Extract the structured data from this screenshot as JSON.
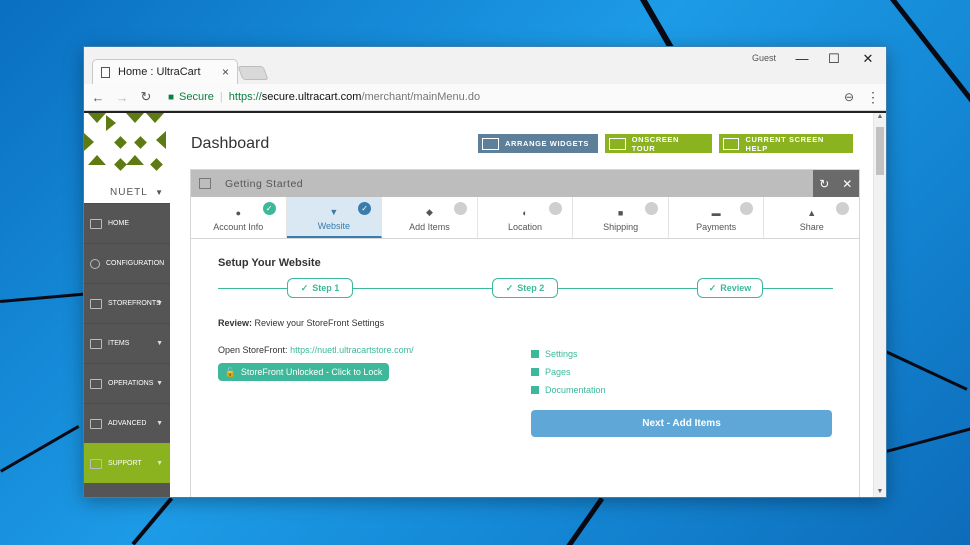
{
  "browser": {
    "tab_title": "Home : UltraCart",
    "tab_close": "×",
    "guest_label": "Guest",
    "minimize": "—",
    "maximize": "☐",
    "close": "✕",
    "secure_label": "Secure",
    "url_scheme": "https://",
    "url_host": "secure.ultracart.com",
    "url_path": "/merchant/mainMenu.do",
    "icons": [
      "back-arrow-icon",
      "forward-arrow-icon",
      "reload-icon",
      "lock-icon",
      "zoom-icon",
      "menu-dots-icon"
    ]
  },
  "sidebar": {
    "account_name": "NUETL",
    "items": [
      {
        "label": "HOME",
        "icon": "home-icon",
        "has_arrow": false
      },
      {
        "label": "CONFIGURATION",
        "icon": "gear-icon",
        "has_arrow": false
      },
      {
        "label": "STOREFRONTS",
        "icon": "storefront-icon",
        "has_arrow": true
      },
      {
        "label": "ITEMS",
        "icon": "box-icon",
        "has_arrow": true
      },
      {
        "label": "OPERATIONS",
        "icon": "clipboard-icon",
        "has_arrow": true
      },
      {
        "label": "ADVANCED",
        "icon": "code-icon",
        "has_arrow": true
      },
      {
        "label": "SUPPORT",
        "icon": "plus-square-icon",
        "has_arrow": true
      }
    ],
    "active_item": "SUPPORT"
  },
  "header": {
    "title": "Dashboard",
    "arrange_widgets": "ARRANGE WIDGETS",
    "onscreen_tour": "ONSCREEN TOUR",
    "current_screen_help": "CURRENT SCREEN HELP"
  },
  "panel": {
    "title": "Getting Started",
    "steps": [
      {
        "label": "Account Info",
        "icon": "user-icon",
        "done": true,
        "current": false
      },
      {
        "label": "Website",
        "icon": "cart-icon",
        "done": true,
        "current": true
      },
      {
        "label": "Add Items",
        "icon": "tag-icon",
        "done": false,
        "current": false
      },
      {
        "label": "Location",
        "icon": "globe-icon",
        "done": false,
        "current": false
      },
      {
        "label": "Shipping",
        "icon": "package-icon",
        "done": false,
        "current": false
      },
      {
        "label": "Payments",
        "icon": "credit-card-icon",
        "done": false,
        "current": false
      },
      {
        "label": "Share",
        "icon": "thumbs-up-icon",
        "done": false,
        "current": false
      }
    ]
  },
  "setup": {
    "title": "Setup Your Website",
    "wizard": [
      "Step 1",
      "Step 2",
      "Review"
    ],
    "review_label": "Review:",
    "review_text": "Review your StoreFront Settings",
    "open_label": "Open StoreFront:",
    "open_link": "https://nuetl.ultracartstore.com/",
    "unlock_button": "StoreFront Unlocked - Click to Lock",
    "links": [
      "Settings",
      "Pages",
      "Documentation"
    ],
    "next_button": "Next - Add Items"
  },
  "colors": {
    "accent_green": "#8bb21f",
    "teal": "#3db89a",
    "sidebar_bg": "#555555",
    "next_blue": "#5ea7d6"
  }
}
